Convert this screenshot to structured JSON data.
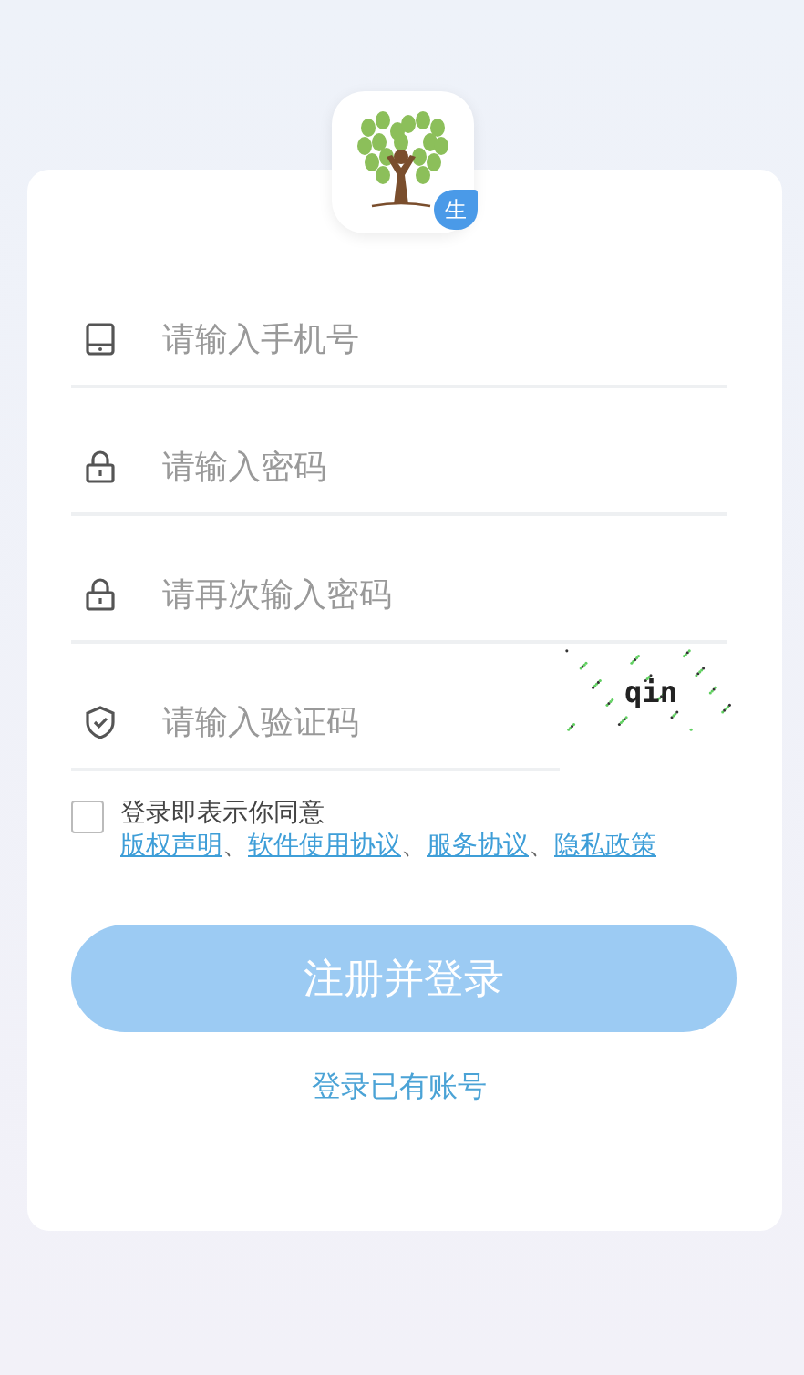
{
  "app_icon": {
    "badge": "生"
  },
  "fields": [
    {
      "kind": "phone",
      "placeholder": "请输入手机号"
    },
    {
      "kind": "password",
      "placeholder": "请输入密码"
    },
    {
      "kind": "password",
      "placeholder": "请再次输入密码"
    },
    {
      "kind": "captcha",
      "placeholder": "请输入验证码",
      "captcha": "qin"
    }
  ],
  "agreement": {
    "checked": false,
    "text": "登录即表示你同意",
    "links": [
      "版权声明",
      "软件使用协议",
      "服务协议",
      "隐私政策"
    ],
    "separator": "、"
  },
  "register_button": {
    "label": "注册并登录",
    "disabled": true
  },
  "login_link": "登录已有账号"
}
